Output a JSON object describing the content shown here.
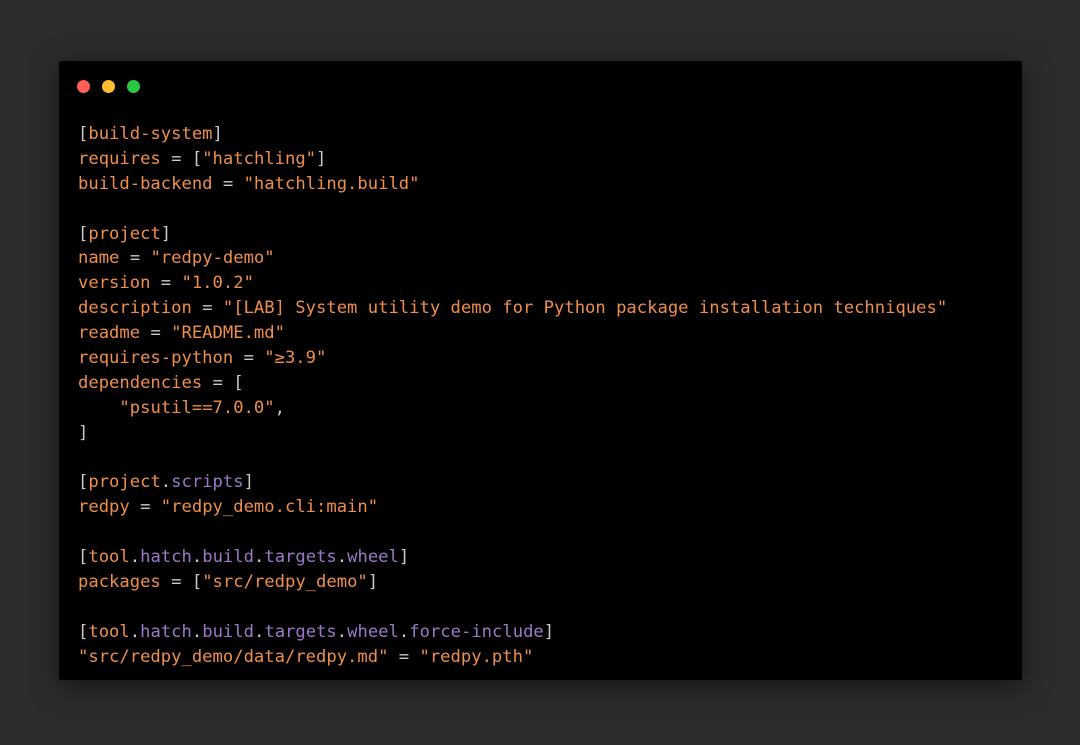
{
  "window": {
    "controls": [
      {
        "name": "close",
        "color": "#ff5f57"
      },
      {
        "name": "minimize",
        "color": "#febc2e"
      },
      {
        "name": "maximize",
        "color": "#28c840"
      }
    ]
  },
  "colors": {
    "background": "#2b2c2e",
    "window": "#000000",
    "key": "#ee8e4a",
    "string": "#ee8e4a",
    "punctuation": "#c9c9c9",
    "subsection": "#9c78c6"
  },
  "code": {
    "language": "toml",
    "lines": [
      [
        {
          "t": "bracket",
          "v": "["
        },
        {
          "t": "section",
          "v": "build-system"
        },
        {
          "t": "bracket",
          "v": "]"
        }
      ],
      [
        {
          "t": "key",
          "v": "requires"
        },
        {
          "t": "op",
          "v": " = "
        },
        {
          "t": "punct",
          "v": "["
        },
        {
          "t": "str",
          "v": "\"hatchling\""
        },
        {
          "t": "punct",
          "v": "]"
        }
      ],
      [
        {
          "t": "key",
          "v": "build-backend"
        },
        {
          "t": "op",
          "v": " = "
        },
        {
          "t": "str",
          "v": "\"hatchling.build\""
        }
      ],
      [],
      [
        {
          "t": "bracket",
          "v": "["
        },
        {
          "t": "section",
          "v": "project"
        },
        {
          "t": "bracket",
          "v": "]"
        }
      ],
      [
        {
          "t": "key",
          "v": "name"
        },
        {
          "t": "op",
          "v": " = "
        },
        {
          "t": "str",
          "v": "\"redpy-demo\""
        }
      ],
      [
        {
          "t": "key",
          "v": "version"
        },
        {
          "t": "op",
          "v": " = "
        },
        {
          "t": "str",
          "v": "\"1.0.2\""
        }
      ],
      [
        {
          "t": "key",
          "v": "description"
        },
        {
          "t": "op",
          "v": " = "
        },
        {
          "t": "str",
          "v": "\"[LAB] System utility demo for Python package installation techniques\""
        }
      ],
      [
        {
          "t": "key",
          "v": "readme"
        },
        {
          "t": "op",
          "v": " = "
        },
        {
          "t": "str",
          "v": "\"README.md\""
        }
      ],
      [
        {
          "t": "key",
          "v": "requires-python"
        },
        {
          "t": "op",
          "v": " = "
        },
        {
          "t": "str",
          "v": "\"≥3.9\""
        }
      ],
      [
        {
          "t": "key",
          "v": "dependencies"
        },
        {
          "t": "op",
          "v": " = "
        },
        {
          "t": "punct",
          "v": "["
        }
      ],
      [
        {
          "t": "text",
          "v": "    "
        },
        {
          "t": "str",
          "v": "\"psutil==7.0.0\""
        },
        {
          "t": "punct",
          "v": ","
        }
      ],
      [
        {
          "t": "punct",
          "v": "]"
        }
      ],
      [],
      [
        {
          "t": "bracket",
          "v": "["
        },
        {
          "t": "section",
          "v": "project"
        },
        {
          "t": "dot",
          "v": "."
        },
        {
          "t": "sub",
          "v": "scripts"
        },
        {
          "t": "bracket",
          "v": "]"
        }
      ],
      [
        {
          "t": "key",
          "v": "redpy"
        },
        {
          "t": "op",
          "v": " = "
        },
        {
          "t": "str",
          "v": "\"redpy_demo.cli:main\""
        }
      ],
      [],
      [
        {
          "t": "bracket",
          "v": "["
        },
        {
          "t": "section",
          "v": "tool"
        },
        {
          "t": "dot",
          "v": "."
        },
        {
          "t": "sub",
          "v": "hatch"
        },
        {
          "t": "dot",
          "v": "."
        },
        {
          "t": "sub",
          "v": "build"
        },
        {
          "t": "dot",
          "v": "."
        },
        {
          "t": "sub",
          "v": "targets"
        },
        {
          "t": "dot",
          "v": "."
        },
        {
          "t": "sub",
          "v": "wheel"
        },
        {
          "t": "bracket",
          "v": "]"
        }
      ],
      [
        {
          "t": "key",
          "v": "packages"
        },
        {
          "t": "op",
          "v": " = "
        },
        {
          "t": "punct",
          "v": "["
        },
        {
          "t": "str",
          "v": "\"src/redpy_demo\""
        },
        {
          "t": "punct",
          "v": "]"
        }
      ],
      [],
      [
        {
          "t": "bracket",
          "v": "["
        },
        {
          "t": "section",
          "v": "tool"
        },
        {
          "t": "dot",
          "v": "."
        },
        {
          "t": "sub",
          "v": "hatch"
        },
        {
          "t": "dot",
          "v": "."
        },
        {
          "t": "sub",
          "v": "build"
        },
        {
          "t": "dot",
          "v": "."
        },
        {
          "t": "sub",
          "v": "targets"
        },
        {
          "t": "dot",
          "v": "."
        },
        {
          "t": "sub",
          "v": "wheel"
        },
        {
          "t": "dot",
          "v": "."
        },
        {
          "t": "sub",
          "v": "force-include"
        },
        {
          "t": "bracket",
          "v": "]"
        }
      ],
      [
        {
          "t": "str",
          "v": "\"src/redpy_demo/data/redpy.md\""
        },
        {
          "t": "op",
          "v": " = "
        },
        {
          "t": "str",
          "v": "\"redpy.pth\""
        }
      ]
    ]
  }
}
